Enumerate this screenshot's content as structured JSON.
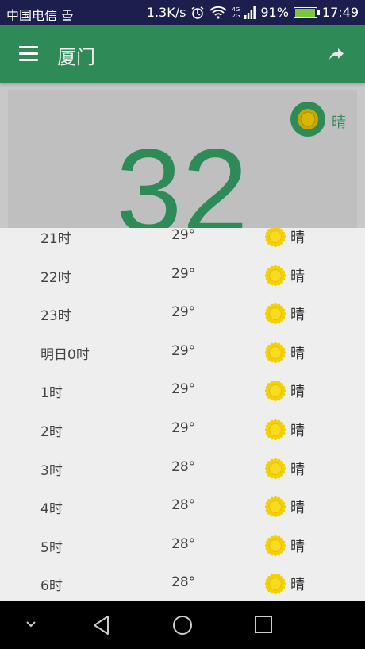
{
  "status_bar": {
    "carrier": "中国电信",
    "speed": "1.3K/s",
    "network_tag_top": "4G",
    "network_tag_bottom": "2G",
    "battery": "91%",
    "time": "17:49"
  },
  "app_bar": {
    "title": "厦门"
  },
  "current": {
    "condition": "晴",
    "temperature": "32"
  },
  "hourly": [
    {
      "time": "21时",
      "temp": "29°",
      "condition": "晴"
    },
    {
      "time": "22时",
      "temp": "29°",
      "condition": "晴"
    },
    {
      "time": "23时",
      "temp": "29°",
      "condition": "晴"
    },
    {
      "time": "明日0时",
      "temp": "29°",
      "condition": "晴"
    },
    {
      "time": "1时",
      "temp": "29°",
      "condition": "晴"
    },
    {
      "time": "2时",
      "temp": "29°",
      "condition": "晴"
    },
    {
      "time": "3时",
      "temp": "28°",
      "condition": "晴"
    },
    {
      "time": "4时",
      "temp": "28°",
      "condition": "晴"
    },
    {
      "time": "5时",
      "temp": "28°",
      "condition": "晴"
    },
    {
      "time": "6时",
      "temp": "28°",
      "condition": "晴"
    }
  ],
  "colors": {
    "primary": "#2e8b57",
    "status_bar": "#1c1f4e",
    "sun": "#f5d000",
    "sheet_bg": "#eeeeee"
  },
  "icons": {
    "menu": "menu-icon",
    "share": "share-icon",
    "sun": "sun-icon"
  }
}
